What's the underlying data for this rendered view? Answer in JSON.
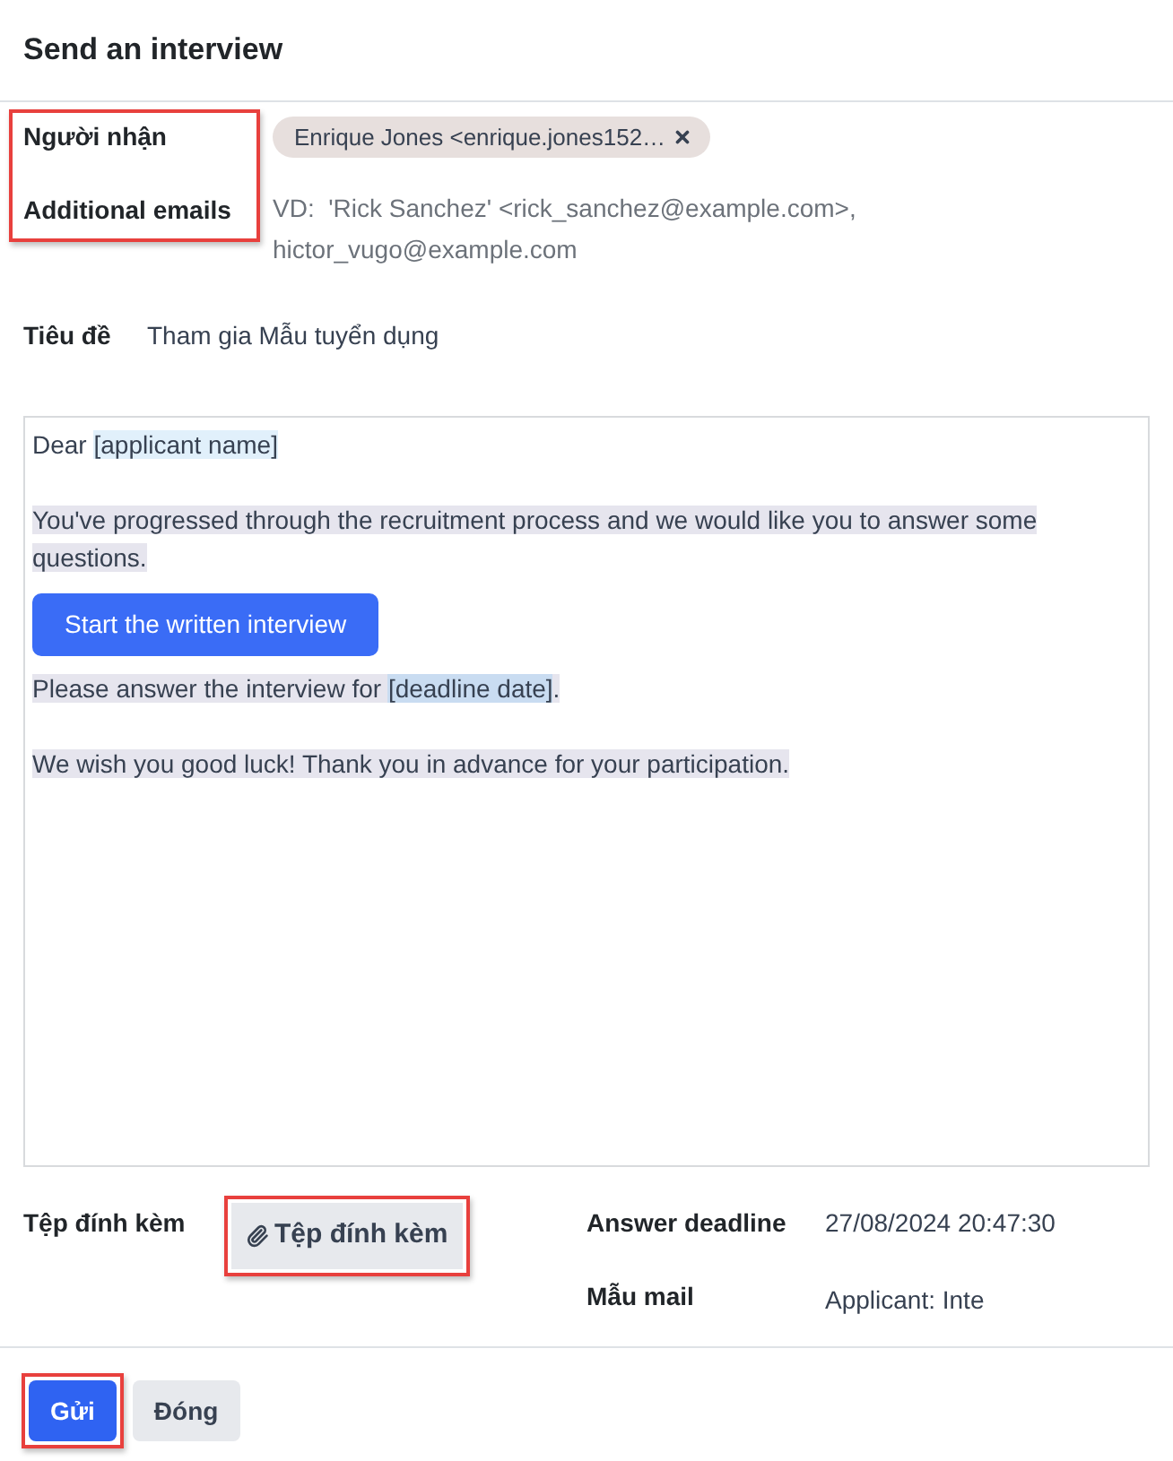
{
  "dialog": {
    "title": "Send an interview"
  },
  "recipients_section": {
    "highlighted": true,
    "recipients": {
      "label": "Người nhận",
      "tags": [
        {
          "text": "Enrique Jones <enrique.jones152…"
        }
      ]
    },
    "additional_emails": {
      "label": "Additional emails",
      "placeholder": "VD:  'Rick Sanchez' <rick_sanchez@example.com>, hictor_vugo@example.com"
    }
  },
  "subject": {
    "label": "Tiêu đề",
    "value": "Tham gia Mẫu tuyển dụng"
  },
  "body": {
    "blocks": [
      {
        "kind": "paragraph",
        "segments": [
          {
            "kind": "text",
            "text": "Dear ",
            "selected": false
          },
          {
            "kind": "placeholder",
            "text": "[applicant name]",
            "selected": false
          }
        ]
      },
      {
        "kind": "blank"
      },
      {
        "kind": "paragraph",
        "segments": [
          {
            "kind": "text",
            "text": "You've progressed through the recruitment process and we would like you to answer some questions.",
            "selected": true
          }
        ]
      },
      {
        "kind": "button",
        "label": "Start the written interview"
      },
      {
        "kind": "paragraph",
        "segments": [
          {
            "kind": "text",
            "text": "Please answer the interview for ",
            "selected": true
          },
          {
            "kind": "placeholder",
            "text": "[deadline date]",
            "selected": true
          },
          {
            "kind": "text",
            "text": ".",
            "selected": true
          }
        ]
      },
      {
        "kind": "blank"
      },
      {
        "kind": "paragraph",
        "segments": [
          {
            "kind": "text",
            "text": "We wish you good luck! Thank you in advance for your participation.",
            "selected": true
          }
        ]
      }
    ]
  },
  "attachments": {
    "label": "Tệp đính kèm",
    "button": {
      "label": "Tệp đính kèm",
      "highlighted": true
    }
  },
  "answer_deadline": {
    "label": "Answer deadline",
    "value": "27/08/2024 20:47:30"
  },
  "mail_template": {
    "label": "Mẫu mail",
    "value": "Applicant: Inte"
  },
  "footer": {
    "buttons": [
      {
        "label": "Gửi",
        "kind": "primary",
        "highlighted": true
      },
      {
        "label": "Đóng",
        "kind": "secondary",
        "highlighted": false
      }
    ]
  }
}
